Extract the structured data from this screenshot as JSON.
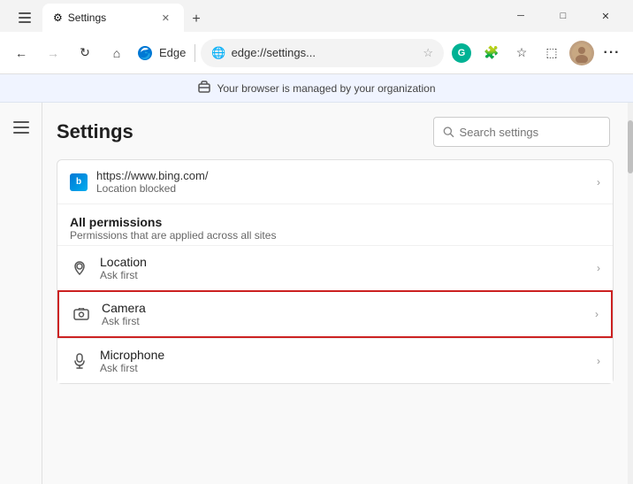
{
  "titleBar": {
    "tab": {
      "icon": "⚙",
      "title": "Settings",
      "closeLabel": "✕"
    },
    "newTabLabel": "+",
    "windowControls": {
      "minimize": "─",
      "maximize": "□",
      "close": "✕"
    }
  },
  "navBar": {
    "backLabel": "←",
    "forwardLabel": "→",
    "refreshLabel": "↻",
    "homeLabel": "⌂",
    "edgeBrandLabel": "Edge",
    "addressText": "edge://settings...",
    "addressIcon": "🌐",
    "favoriteIcon": "☆",
    "profileIcon": "G",
    "extensionsIcon": "🧩",
    "collectionsIcon": "≡",
    "tabsIcon": "⬚",
    "menuIcon": "•••"
  },
  "infoBar": {
    "icon": "🎒",
    "text": "Your browser is managed by your organization"
  },
  "settings": {
    "menuIcon": "☰",
    "title": "Settings",
    "searchPlaceholder": "Search settings"
  },
  "bingEntry": {
    "iconLabel": "b",
    "url": "https://www.bing.com/",
    "status": "Location blocked",
    "chevron": "›"
  },
  "allPermissions": {
    "title": "All permissions",
    "subtitle": "Permissions that are applied across all sites",
    "items": [
      {
        "id": "location",
        "icon": "◎",
        "name": "Location",
        "status": "Ask first",
        "chevron": "›",
        "highlighted": false
      },
      {
        "id": "camera",
        "icon": "📷",
        "name": "Camera",
        "status": "Ask first",
        "chevron": "›",
        "highlighted": true
      },
      {
        "id": "microphone",
        "icon": "🎤",
        "name": "Microphone",
        "status": "Ask first",
        "chevron": "›",
        "highlighted": false
      }
    ]
  }
}
